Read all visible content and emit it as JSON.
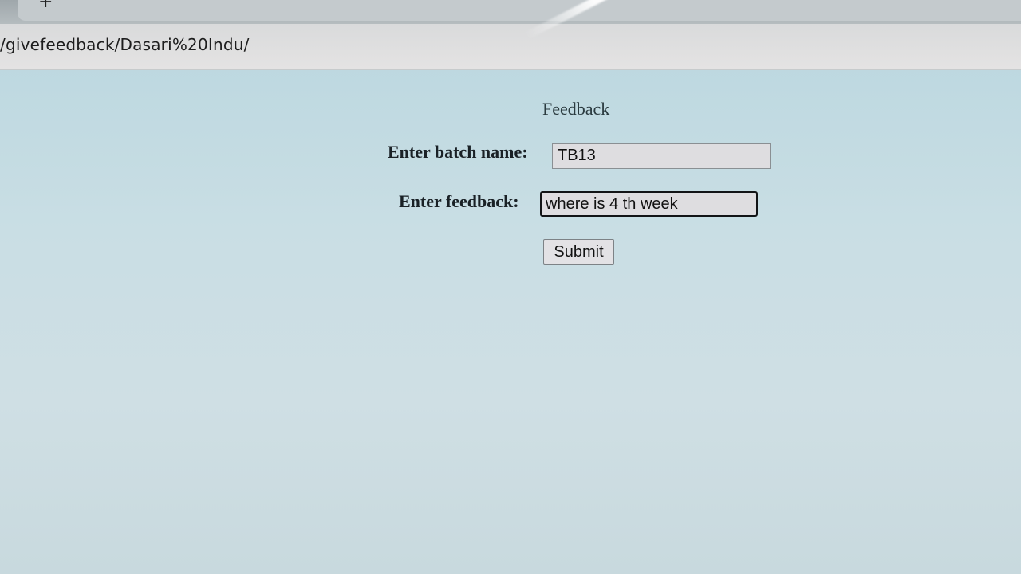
{
  "browser": {
    "new_tab_symbol": "+",
    "url": "/givefeedback/Dasari%20Indu/"
  },
  "form": {
    "title": "Feedback",
    "batch_label": "Enter batch name:",
    "batch_value": "TB13",
    "feedback_label": "Enter feedback:",
    "feedback_value": "where is 4 th week",
    "submit_label": "Submit"
  }
}
